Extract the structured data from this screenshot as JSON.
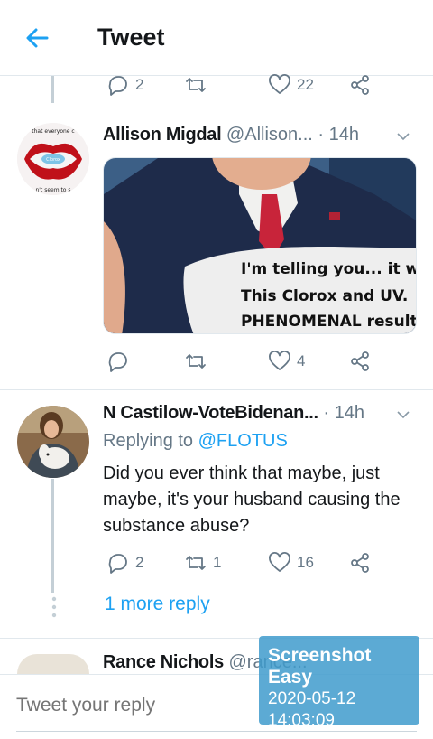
{
  "header": {
    "title": "Tweet",
    "back_icon": "arrow-left-icon"
  },
  "prev_tweet_actions": {
    "reply_count": "2",
    "retweet_count": "",
    "like_count": "22"
  },
  "tweets": [
    {
      "name": "Allison Migdal",
      "handle": "@Allison...",
      "time": "· 14h",
      "image_caption": [
        "I'm telling you... it works.",
        "This Clorox and UV.",
        "PHENOMENAL results."
      ],
      "avatar_text_top": "that everyone c",
      "avatar_text_bottom": "n't seem to s",
      "avatar_pill": "Clorox",
      "actions": {
        "reply_count": "",
        "retweet_count": "",
        "like_count": "4"
      }
    },
    {
      "name": "N Castilow-VoteBidenan...",
      "handle": "",
      "time": "· 14h",
      "replying_prefix": "Replying to ",
      "replying_mention": "@FLOTUS",
      "text": "Did you ever think that maybe, just maybe, it's your husband causing the substance abuse?",
      "actions": {
        "reply_count": "2",
        "retweet_count": "1",
        "like_count": "16"
      },
      "more_reply": "1 more reply"
    },
    {
      "name": "Rance Nichols",
      "handle": "@rance...",
      "time": ""
    }
  ],
  "reply_bar": {
    "placeholder": "Tweet your reply"
  },
  "watermark": {
    "title": "Screenshot Easy",
    "date": "2020-05-12",
    "time": "14:03:09"
  },
  "colors": {
    "accent": "#1da1f2",
    "muted": "#657786",
    "divider": "#e1e8ed"
  }
}
